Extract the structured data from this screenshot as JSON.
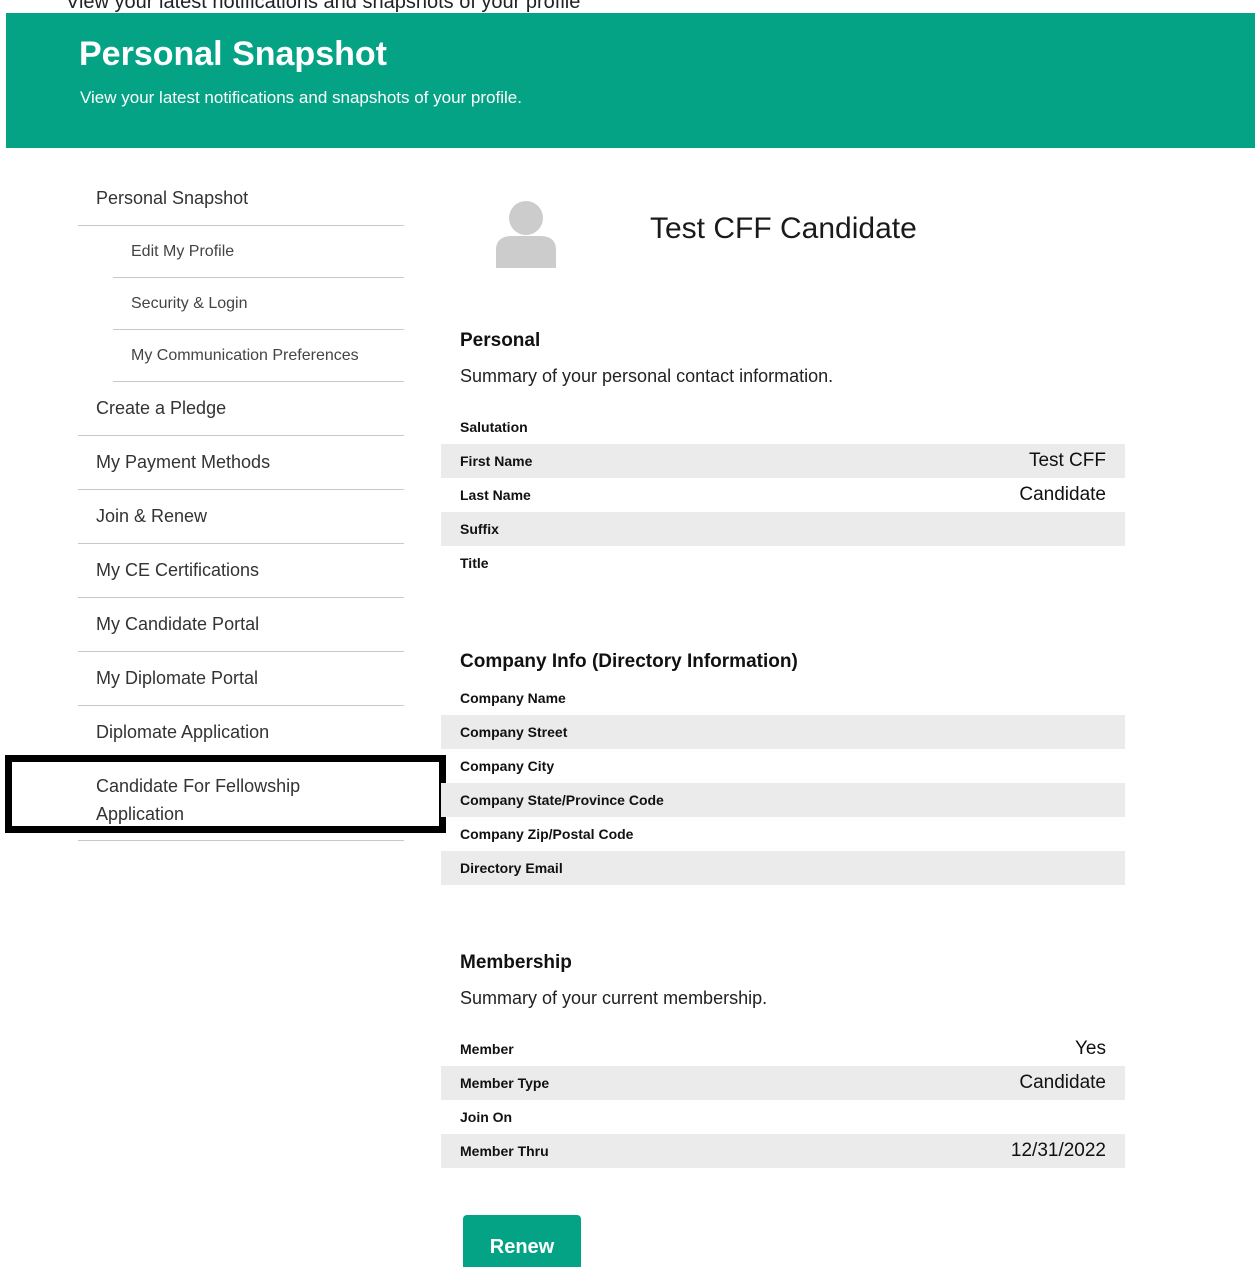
{
  "top_strip": {
    "text": "View your latest notifications and snapshots of your profile"
  },
  "header": {
    "title": "Personal Snapshot",
    "subtitle": "View your latest notifications and snapshots of your profile."
  },
  "sidebar": {
    "items": [
      {
        "label": "Personal Snapshot"
      },
      {
        "label": "Edit My Profile"
      },
      {
        "label": "Security & Login"
      },
      {
        "label": "My Communication Preferences"
      },
      {
        "label": "Create a Pledge"
      },
      {
        "label": "My Payment Methods"
      },
      {
        "label": "Join & Renew"
      },
      {
        "label": "My CE Certifications"
      },
      {
        "label": "My Candidate Portal"
      },
      {
        "label": "My Diplomate Portal"
      },
      {
        "label": "Diplomate Application"
      },
      {
        "label": "Candidate For Fellowship Application"
      }
    ]
  },
  "profile": {
    "name": "Test CFF Candidate",
    "avatar_icon": "user-avatar-icon"
  },
  "personal": {
    "title": "Personal",
    "description": "Summary of your personal contact information.",
    "rows": [
      {
        "label": "Salutation",
        "value": ""
      },
      {
        "label": "First Name",
        "value": "Test CFF"
      },
      {
        "label": "Last Name",
        "value": "Candidate"
      },
      {
        "label": "Suffix",
        "value": ""
      },
      {
        "label": "Title",
        "value": ""
      }
    ]
  },
  "company": {
    "title": "Company Info (Directory Information)",
    "rows": [
      {
        "label": "Company Name",
        "value": ""
      },
      {
        "label": "Company Street",
        "value": ""
      },
      {
        "label": "Company City",
        "value": ""
      },
      {
        "label": "Company State/Province Code",
        "value": ""
      },
      {
        "label": "Company Zip/Postal Code",
        "value": ""
      },
      {
        "label": "Directory Email",
        "value": ""
      }
    ]
  },
  "membership": {
    "title": "Membership",
    "description": "Summary of your current membership.",
    "rows": [
      {
        "label": "Member",
        "value": "Yes"
      },
      {
        "label": "Member Type",
        "value": "Candidate"
      },
      {
        "label": "Join On",
        "value": ""
      },
      {
        "label": "Member Thru",
        "value": "12/31/2022"
      }
    ],
    "renew_label": "Renew"
  },
  "colors": {
    "brand": "#04a386",
    "row_stripe": "#ebebeb"
  }
}
